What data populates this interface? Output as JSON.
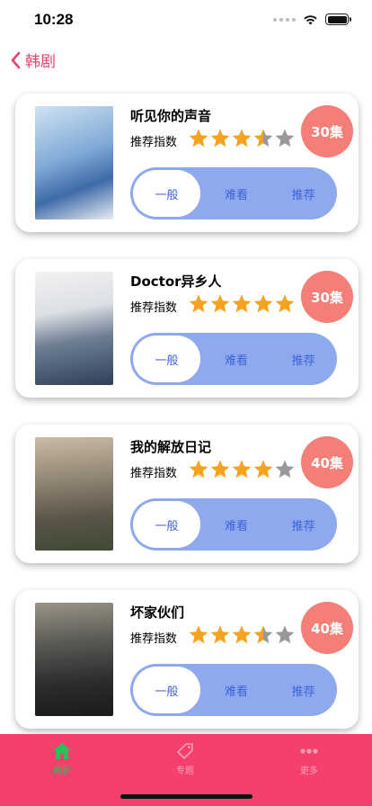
{
  "status_bar": {
    "time": "10:28"
  },
  "nav": {
    "title": "韩剧"
  },
  "dramas": [
    {
      "title": "听见你的声音",
      "rating_label": "推荐指数",
      "rating": 3.5,
      "episodes": "30集",
      "options": [
        "一般",
        "难看",
        "推荐"
      ],
      "selected": 0
    },
    {
      "title": "Doctor异乡人",
      "rating_label": "推荐指数",
      "rating": 5,
      "episodes": "30集",
      "options": [
        "一般",
        "难看",
        "推荐"
      ],
      "selected": 0
    },
    {
      "title": "我的解放日记",
      "rating_label": "推荐指数",
      "rating": 4,
      "episodes": "40集",
      "options": [
        "一般",
        "难看",
        "推荐"
      ],
      "selected": 0
    },
    {
      "title": "坏家伙们",
      "rating_label": "推荐指数",
      "rating": 3.5,
      "episodes": "40集",
      "options": [
        "一般",
        "难看",
        "推荐"
      ],
      "selected": 0
    }
  ],
  "tabs": [
    {
      "label": "韩剧",
      "icon": "home-icon",
      "active": true
    },
    {
      "label": "专题",
      "icon": "tag-icon",
      "active": false
    },
    {
      "label": "更多",
      "icon": "more-icon",
      "active": false
    }
  ],
  "colors": {
    "accent": "#f53f6c",
    "badge": "#f37f78",
    "segment": "#8fa9ee",
    "segment_text": "#3d63d6",
    "star_on": "#f4a21f",
    "star_off": "#999999",
    "tab_active": "#2dbd5a",
    "tab_inactive": "#f7a0b6"
  }
}
